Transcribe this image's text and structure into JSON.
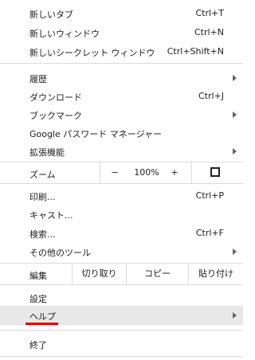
{
  "menu": {
    "new_tab": {
      "label": "新しいタブ",
      "shortcut": "Ctrl+T"
    },
    "new_window": {
      "label": "新しいウィンドウ",
      "shortcut": "Ctrl+N"
    },
    "new_incognito": {
      "label": "新しいシークレット ウィンドウ",
      "shortcut": "Ctrl+Shift+N"
    },
    "history": {
      "label": "履歴"
    },
    "downloads": {
      "label": "ダウンロード",
      "shortcut": "Ctrl+J"
    },
    "bookmarks": {
      "label": "ブックマーク"
    },
    "password_manager": {
      "label": "Google パスワード マネージャー"
    },
    "extensions": {
      "label": "拡張機能"
    },
    "zoom": {
      "label": "ズーム",
      "minus": "−",
      "value": "100%",
      "plus": "+"
    },
    "print": {
      "label": "印刷...",
      "shortcut": "Ctrl+P"
    },
    "cast": {
      "label": "キャスト..."
    },
    "find": {
      "label": "検索...",
      "shortcut": "Ctrl+F"
    },
    "more_tools": {
      "label": "その他のツール"
    },
    "edit": {
      "label": "編集",
      "cut": "切り取り",
      "copy": "コピー",
      "paste": "貼り付け"
    },
    "settings": {
      "label": "設定"
    },
    "help": {
      "label": "ヘルプ"
    },
    "exit": {
      "label": "終了"
    }
  },
  "icons": {
    "submenu": "chevron-right-icon",
    "fullscreen": "fullscreen-icon"
  },
  "colors": {
    "highlight_bg": "#e8e8e8",
    "separator": "#dadce0",
    "annotation_underline": "#e00000"
  }
}
